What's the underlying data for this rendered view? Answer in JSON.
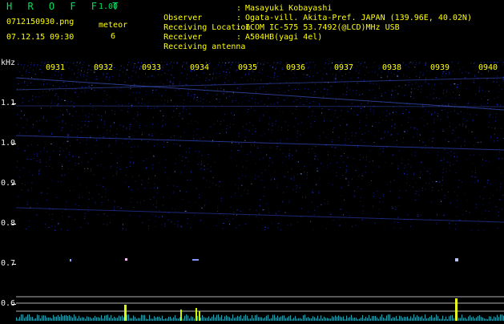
{
  "header": {
    "title": "H R O F F T",
    "version": "1.00",
    "filename": "0712150930.png",
    "datetime": "07.12.15 09:30",
    "meteor_label": "meteor",
    "meteor_count": "6"
  },
  "info": [
    {
      "key": "Observer",
      "sep": ":",
      "value": "Masayuki Kobayashi"
    },
    {
      "key": "Receiving Location",
      "sep": ":",
      "value": "Ogata-vill. Akita-Pref. JAPAN (139.96E, 40.02N)"
    },
    {
      "key": "Receiver",
      "sep": ":",
      "value": "ICOM IC-575 53.7492(@LCD)MHz USB"
    },
    {
      "key": "Receiving antenna",
      "sep": ":",
      "value": "A504HB(yagi 4el)"
    }
  ],
  "spectrogram": {
    "unit_label": "kHz",
    "freq_ticks": [
      "1.1",
      "1.0",
      "0.9",
      "0.8",
      "0.7",
      "0.6"
    ],
    "time_ticks": [
      "0931",
      "0932",
      "0933",
      "0934",
      "0935",
      "0936",
      "0937",
      "0938",
      "0939",
      "0940"
    ],
    "colors": {
      "background": "#000000",
      "noise": "#1a2bd9",
      "text_header": "#00e25a",
      "text_axis": "#ffff00",
      "signal": "#c8f000"
    }
  }
}
